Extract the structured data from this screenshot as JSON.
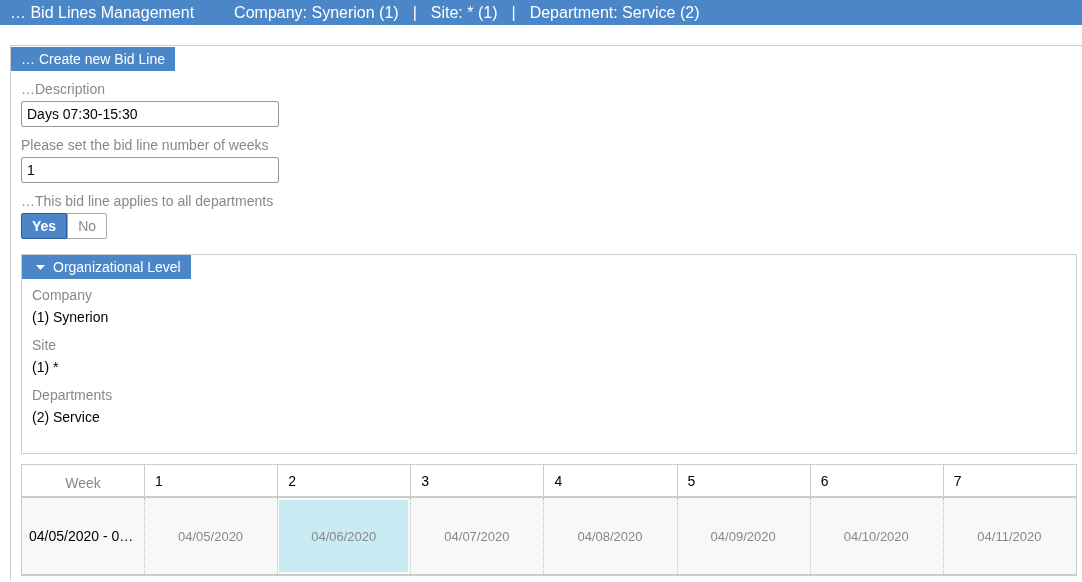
{
  "header": {
    "title": "… Bid Lines Management",
    "context": [
      "Company: Synerion (1)",
      "|",
      "Site: * (1)",
      "|",
      "Department: Service (2)"
    ]
  },
  "panel": {
    "title": "… Create new Bid Line",
    "fields": [
      {
        "label": "…Description",
        "value": "Days 07:30-15:30"
      },
      {
        "label": "Please set the bid line number of weeks",
        "value": "1"
      }
    ],
    "toggle": {
      "label": "…This bid line applies to all departments",
      "options": [
        {
          "label": "Yes",
          "selected": true
        },
        {
          "label": "No",
          "selected": false
        }
      ]
    },
    "org_level": {
      "title": "Organizational Level",
      "expanded": true,
      "items": [
        {
          "label": "Company",
          "value": "(1) Synerion"
        },
        {
          "label": "Site",
          "value": "(1) *"
        },
        {
          "label": "Departments",
          "value": "(2) Service"
        }
      ]
    },
    "table": {
      "columns": [
        "Week",
        "1",
        "2",
        "3",
        "4",
        "5",
        "6",
        "7"
      ],
      "rows": [
        {
          "label": "04/05/2020 - 0…",
          "cells": [
            {
              "text": "04/05/2020",
              "selected": false
            },
            {
              "text": "04/06/2020",
              "selected": true
            },
            {
              "text": "04/07/2020",
              "selected": false
            },
            {
              "text": "04/08/2020",
              "selected": false
            },
            {
              "text": "04/09/2020",
              "selected": false
            },
            {
              "text": "04/10/2020",
              "selected": false
            },
            {
              "text": "04/11/2020",
              "selected": false
            }
          ]
        }
      ]
    }
  }
}
